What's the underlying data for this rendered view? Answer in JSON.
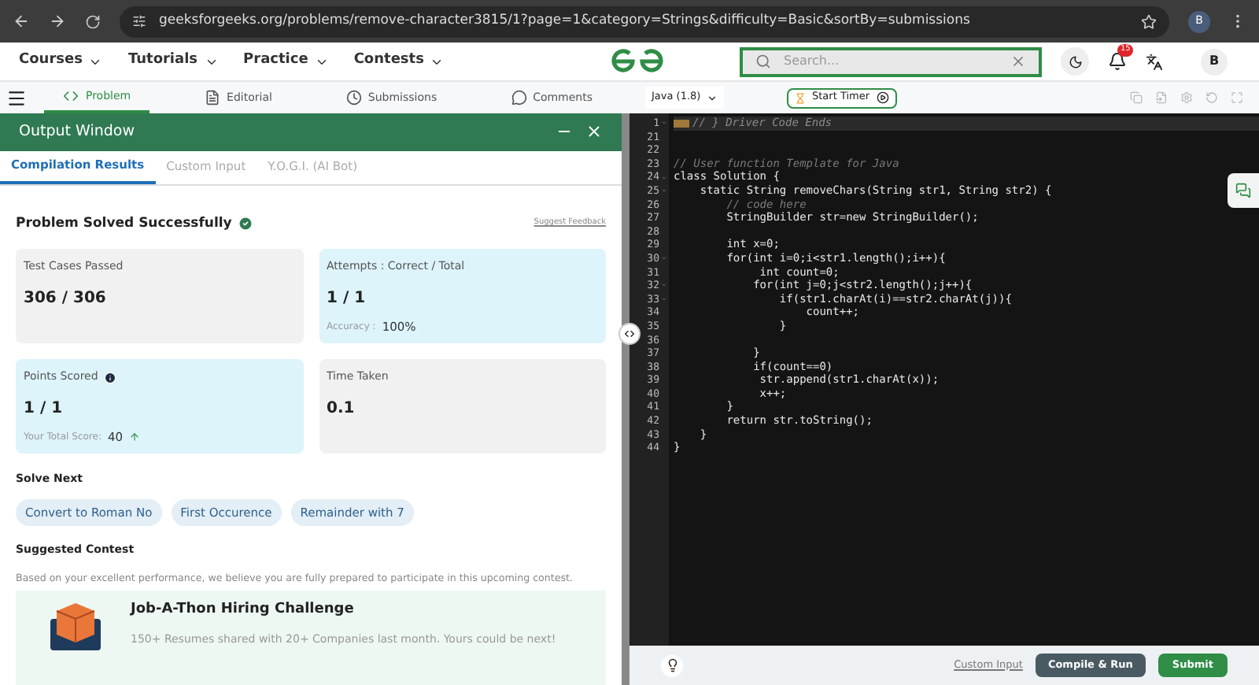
{
  "browser": {
    "url": "geeksforgeeks.org/problems/remove-character3815/1?page=1&category=Strings&difficulty=Basic&sortBy=submissions",
    "profile": "B"
  },
  "nav": {
    "menus": [
      "Courses",
      "Tutorials",
      "Practice",
      "Contests"
    ],
    "search": {
      "placeholder": "Search..."
    },
    "notification_count": "15",
    "avatar": "B"
  },
  "problem_tabs": [
    {
      "label": "Problem",
      "selected": true,
      "kind": "code"
    },
    {
      "label": "Editorial",
      "selected": false,
      "kind": "doc"
    },
    {
      "label": "Submissions",
      "selected": false,
      "kind": "clock"
    },
    {
      "label": "Comments",
      "selected": false,
      "kind": "comment"
    }
  ],
  "output_window": {
    "title": "Output Window",
    "tabs": [
      {
        "label": "Compilation Results",
        "selected": true
      },
      {
        "label": "Custom Input",
        "selected": false
      },
      {
        "label": "Y.O.G.I. (AI Bot)",
        "selected": false
      }
    ],
    "status": "Problem Solved Successfully",
    "feedback_link": "Suggest Feedback",
    "stats": [
      {
        "label": "Test Cases Passed",
        "value": "306 / 306",
        "highlight": false
      },
      {
        "label": "Attempts : Correct / Total",
        "value": "1 / 1",
        "note_label": "Accuracy :",
        "note_value": "100%",
        "highlight": true
      },
      {
        "label": "Points Scored",
        "value": "1 / 1",
        "note_label": "Your Total Score:",
        "note_value": "40",
        "info": true,
        "trend_up": true,
        "highlight": true
      },
      {
        "label": "Time Taken",
        "value": "0.1",
        "highlight": false
      }
    ],
    "solve_next": {
      "heading": "Solve Next",
      "items": [
        "Convert to Roman No",
        "First Occurence",
        "Remainder with 7"
      ]
    },
    "suggested_contest": {
      "heading": "Suggested Contest",
      "description": "Based on your excellent performance, we believe you are fully prepared to participate in this upcoming contest.",
      "title": "Job-A-Thon Hiring Challenge",
      "text": "150+ Resumes shared with 20+ Companies last month. Yours could be next!"
    }
  },
  "editor": {
    "language": "Java (1.8)",
    "timer_button": "Start Timer",
    "lines": [
      {
        "num": "1",
        "text": "// } Driver Code Ends",
        "kind": "folded",
        "foldable": true
      },
      {
        "num": "21",
        "kind": "code"
      },
      {
        "num": "22",
        "kind": "code"
      },
      {
        "num": "23",
        "text": "// User function Template for Java",
        "kind": "comment"
      },
      {
        "num": "24",
        "text": "class Solution {",
        "kind": "code",
        "foldable": true
      },
      {
        "num": "25",
        "text": "    static String removeChars(String str1, String str2) {",
        "kind": "code",
        "foldable": true
      },
      {
        "num": "26",
        "text": "        // code here",
        "kind": "comment"
      },
      {
        "num": "27",
        "text": "        StringBuilder str=new StringBuilder();",
        "kind": "code"
      },
      {
        "num": "28",
        "kind": "code"
      },
      {
        "num": "29",
        "text": "        int x=0;",
        "kind": "code"
      },
      {
        "num": "30",
        "text": "        for(int i=0;i<str1.length();i++){",
        "kind": "code",
        "foldable": true
      },
      {
        "num": "31",
        "text": "             int count=0;",
        "kind": "code"
      },
      {
        "num": "32",
        "text": "            for(int j=0;j<str2.length();j++){",
        "kind": "code",
        "foldable": true
      },
      {
        "num": "33",
        "text": "                if(str1.charAt(i)==str2.charAt(j)){",
        "kind": "code",
        "foldable": true
      },
      {
        "num": "34",
        "text": "                    count++;",
        "kind": "code"
      },
      {
        "num": "35",
        "text": "                }",
        "kind": "code"
      },
      {
        "num": "36",
        "kind": "code"
      },
      {
        "num": "37",
        "text": "            }",
        "kind": "code"
      },
      {
        "num": "38",
        "text": "            if(count==0)",
        "kind": "code"
      },
      {
        "num": "39",
        "text": "             str.append(str1.charAt(x));",
        "kind": "code"
      },
      {
        "num": "40",
        "text": "             x++;",
        "kind": "code"
      },
      {
        "num": "41",
        "text": "        }",
        "kind": "code"
      },
      {
        "num": "42",
        "text": "        return str.toString();",
        "kind": "code"
      },
      {
        "num": "43",
        "text": "    }",
        "kind": "code"
      },
      {
        "num": "44",
        "text": "}",
        "kind": "code"
      }
    ],
    "footer": {
      "custom_input": "Custom Input",
      "compile_button": "Compile & Run",
      "submit_button": "Submit"
    }
  }
}
